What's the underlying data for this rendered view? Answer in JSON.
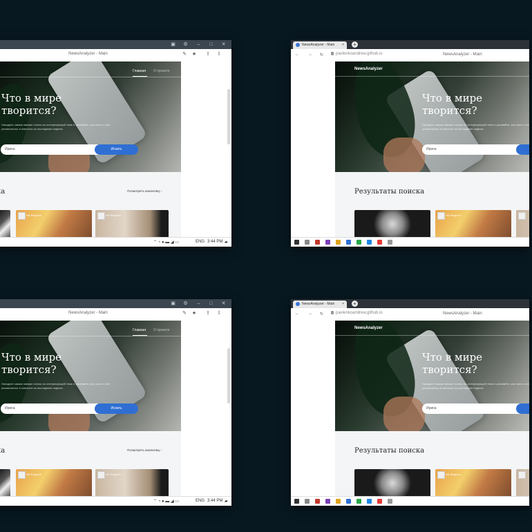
{
  "app": {
    "window_title": "NewsAnalyzer - Main",
    "nav": {
      "main": "Главная",
      "about": "О проекте"
    },
    "logo": "NewsAnalyzer"
  },
  "hero": {
    "headline_line1": "Что в мире",
    "headline_line2": "творится?",
    "subtitle": "Находите самые свежие статьи по интересующей теме и узнавайте, как часто о ней упоминалось в новостях за последнюю неделю.",
    "search_value": "Ирина",
    "search_button": "Искать"
  },
  "results": {
    "title": "Результаты поиска",
    "title_partial": "ка",
    "analytics_link": "Посмотреть аналитику",
    "card_source": "ИА Regnum"
  },
  "browser": {
    "tab_title": "NewsAnalyzer - Main",
    "url": "pavlenkoandrew.github.io"
  },
  "taskbar": {
    "lang": "ENG",
    "time": "3:44 PM"
  },
  "colors": {
    "background": "#081820",
    "accent": "#2f6fd3"
  }
}
